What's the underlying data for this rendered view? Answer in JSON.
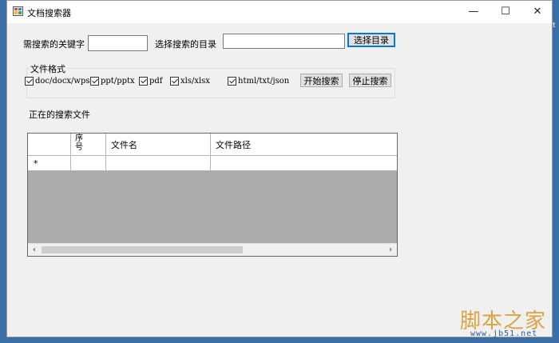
{
  "window": {
    "title": "文档搜索器",
    "controls": {
      "minimize": "—",
      "maximize": "☐",
      "close": "✕"
    }
  },
  "search": {
    "keyword_label": "需搜索的关键字",
    "keyword_value": "",
    "dir_label": "选择搜索的目录",
    "dir_value": "",
    "choose_dir_button": "选择目录"
  },
  "formats": {
    "group_title": "文件格式",
    "options": [
      {
        "label": "doc/docx/wps",
        "checked": true
      },
      {
        "label": "ppt/pptx",
        "checked": true
      },
      {
        "label": "pdf",
        "checked": true
      },
      {
        "label": "xls/xlsx",
        "checked": true
      },
      {
        "label": "html/txt/json",
        "checked": true
      }
    ],
    "start_button": "开始搜索",
    "stop_button": "停止搜索"
  },
  "status": {
    "text": "正在的搜索文件"
  },
  "grid": {
    "columns": [
      "序号",
      "文件名",
      "文件路径"
    ],
    "new_row_marker": "*",
    "scroll_left": "‹",
    "scroll_right": "›"
  },
  "watermark": {
    "brand": "脚本之家",
    "url": "www.jb51.net"
  },
  "edge_text": "t",
  "colors": {
    "desktop": "#3a6ea5",
    "window_bg": "#f0f0f0",
    "grid_bg": "#ababab",
    "focus_accent": "#0078d7"
  }
}
